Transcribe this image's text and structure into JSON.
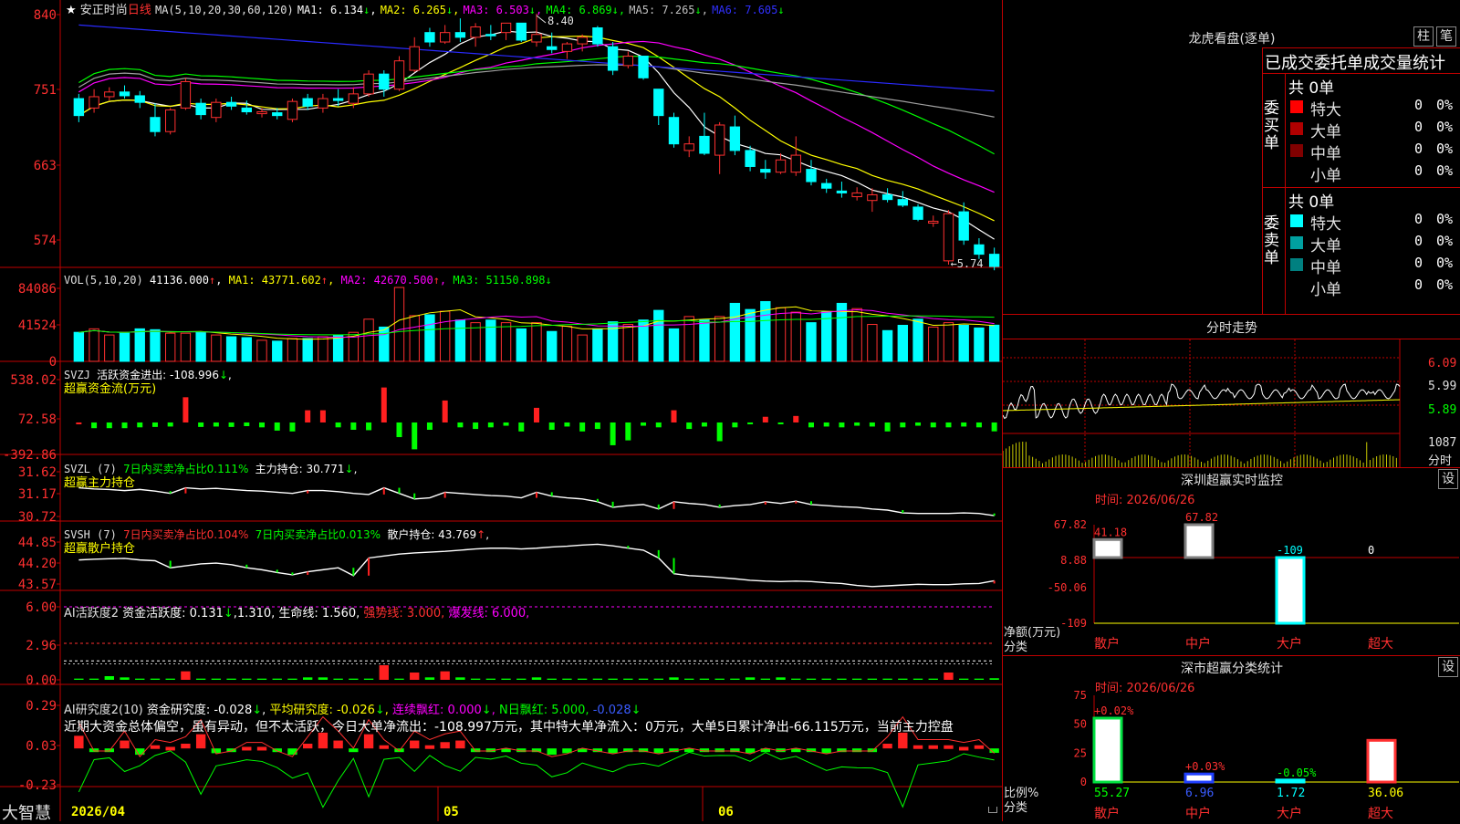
{
  "colors": {
    "up": "#ff3030",
    "down": "#00ffff",
    "grid": "#c00000",
    "ma1": "#ffffff",
    "ma2": "#ffff00",
    "ma3": "#ff00ff",
    "ma4": "#00ff00",
    "ma5": "#a0a0a0",
    "ma6": "#2a2aff"
  },
  "header": {
    "star": "★",
    "stock_name": "安正时尚",
    "period": "日线",
    "ma_params": "MA(5,10,20,30,60,120)",
    "ma1": "MA1: 6.134",
    "ma1_a": "↓",
    "ma2": "MA2: 6.265",
    "ma2_a": "↓",
    "ma3": "MA3: 6.503",
    "ma3_a": "↓",
    "ma4": "MA4: 6.869",
    "ma4_a": "↓",
    "ma5": "MA5: 7.265",
    "ma5_a": "↓",
    "ma6": "MA6: 7.605",
    "ma6_a": "↓"
  },
  "price_axis": [
    "840",
    "751",
    "663",
    "574"
  ],
  "high_label": "8.40",
  "low_label": "5.74",
  "low_arrow": "←",
  "vol_header": {
    "name": "VOL(5,10,20)",
    "val": "41136.000",
    "val_a": "↑",
    "ma1": "MA1: 43771.602",
    "ma1_a": "↑",
    "ma2": "MA2: 42670.500",
    "ma2_a": "↑",
    "ma3": "MA3: 51150.898",
    "ma3_a": "↓"
  },
  "vol_axis": [
    "84086",
    "41524",
    "0"
  ],
  "svzj_header": {
    "name": "SVZJ",
    "label": "活跃资金进出: -108.996",
    "arrow": "↓",
    "comma": ",",
    "sub": "超赢资金流(万元)"
  },
  "svzj_axis": [
    "538.02",
    "72.58",
    "-392.86"
  ],
  "svzl_header": {
    "name": "SVZL (7)",
    "label1": "7日内买卖净占比0.111%",
    "label2": "主力持仓: 30.771",
    "arrow": "↓",
    "comma": ",",
    "sub": "超赢主力持仓"
  },
  "svzl_axis": [
    "31.62",
    "31.17",
    "30.72"
  ],
  "svsh_header": {
    "name": "SVSH (7)",
    "label1": "7日内买卖净占比0.104%",
    "label2": "7日内买卖净占比0.013%",
    "label3": "散户持仓: 43.769",
    "arrow": "↑",
    "comma": ",",
    "sub": "超赢散户持仓"
  },
  "svsh_axis": [
    "44.85",
    "44.20",
    "43.57"
  ],
  "ai_act": {
    "name": "AI活跃度2",
    "l1": "资金活跃度: 0.131",
    "a1": "↓",
    "l2": ",1.310,",
    "l3": "生命线: 1.560,",
    "l4": "强势线: 3.000,",
    "l5": "爆发线: 6.000,"
  },
  "ai_act_axis": [
    "6.00",
    "2.96",
    "0.00"
  ],
  "ai_res": {
    "name": "AI研究度2(10)",
    "l1": "资金研究度: -0.028",
    "a1": "↓",
    "l2": "平均研究度: -0.026",
    "a2": "↓",
    "l3": "连续飘红: 0.000",
    "a3": "↓",
    "l4": "N日飘红: 5.000,",
    "l5": "-0.028",
    "a5": "↓",
    "text": "近期大资金总体偏空，虽有异动，但不太活跃，今日大单净流出：-108.997万元，其中特大单净流入：0万元，大单5日累计净出-66.115万元，当前主力控盘"
  },
  "ai_res_axis": [
    "0.29",
    "0.03",
    "-0.23"
  ],
  "bottom": {
    "brand": "大智慧",
    "date_start": "2026/04",
    "month1": "05",
    "month2": "06"
  },
  "right": {
    "tiger_title": "龙虎看盘(逐单)",
    "btn1": "柱",
    "btn2": "笔",
    "stats_title": "已成交委托单成交量统计",
    "buy": {
      "side": "委买单",
      "total": "共 0单",
      "rows": [
        {
          "label": "特大",
          "count": "0",
          "pct": "0%",
          "color": "#ff0000"
        },
        {
          "label": "大单",
          "count": "0",
          "pct": "0%",
          "color": "#b00000"
        },
        {
          "label": "中单",
          "count": "0",
          "pct": "0%",
          "color": "#800000"
        },
        {
          "label": "小单",
          "count": "0",
          "pct": "0%",
          "color": "#000000"
        }
      ]
    },
    "sell": {
      "side": "委卖单",
      "total": "共 0单",
      "rows": [
        {
          "label": "特大",
          "count": "0",
          "pct": "0%",
          "color": "#00ffff"
        },
        {
          "label": "大单",
          "count": "0",
          "pct": "0%",
          "color": "#00a0a0"
        },
        {
          "label": "中单",
          "count": "0",
          "pct": "0%",
          "color": "#008080"
        },
        {
          "label": "小单",
          "count": "0",
          "pct": "0%",
          "color": "#000000"
        }
      ]
    },
    "intraday_title": "分时走势",
    "intraday_axis": [
      "6.09",
      "5.99",
      "5.89"
    ],
    "intraday_vol": "1087",
    "intraday_vol_unit": "分时",
    "sz_title": "深圳超赢实时监控",
    "sz_btn": "设",
    "sz_time": "时间: 2026/06/26",
    "sz_axis": [
      "67.82",
      "8.88",
      "-50.06",
      "-109"
    ],
    "sz_unit": "净额(万元)",
    "sz_cat_label": "分类",
    "sz_bars": [
      {
        "name": "散户",
        "value": 41.18,
        "label": "41.18"
      },
      {
        "name": "中户",
        "value": 67.82,
        "label": "67.82"
      },
      {
        "name": "大户",
        "value": -109,
        "label": "-109"
      },
      {
        "name": "超大",
        "value": 0,
        "label": "0"
      }
    ],
    "cls_title": "深市超赢分类统计",
    "cls_btn": "设",
    "cls_time": "时间: 2026/06/26",
    "cls_axis": [
      "75",
      "50",
      "25",
      "0"
    ],
    "cls_unit": "比例%",
    "cls_cat_label": "分类",
    "cls_bars": [
      {
        "name": "散户",
        "value": 55.27,
        "top": "+0.02%",
        "bottom": "55.27"
      },
      {
        "name": "中户",
        "value": 6.96,
        "top": "+0.03%",
        "bottom": "6.96"
      },
      {
        "name": "大户",
        "value": 1.72,
        "top": "-0.05%",
        "bottom": "1.72"
      },
      {
        "name": "超大",
        "value": 36.06,
        "top": "",
        "bottom": "36.06"
      }
    ]
  },
  "chart_data": {
    "type": "candlestick",
    "title": "安正时尚 日线",
    "x_range": [
      "2026/04",
      "2026/06/26"
    ],
    "price_ylim": [
      5.74,
      8.4
    ],
    "candles_ohlc": [
      [
        7.5,
        7.55,
        7.25,
        7.32
      ],
      [
        7.4,
        7.6,
        7.35,
        7.52
      ],
      [
        7.52,
        7.62,
        7.48,
        7.57
      ],
      [
        7.57,
        7.64,
        7.5,
        7.53
      ],
      [
        7.53,
        7.58,
        7.4,
        7.46
      ],
      [
        7.3,
        7.45,
        7.1,
        7.15
      ],
      [
        7.15,
        7.4,
        7.12,
        7.38
      ],
      [
        7.4,
        7.72,
        7.38,
        7.68
      ],
      [
        7.45,
        7.5,
        7.28,
        7.33
      ],
      [
        7.3,
        7.5,
        7.25,
        7.46
      ],
      [
        7.46,
        7.52,
        7.38,
        7.42
      ],
      [
        7.4,
        7.48,
        7.33,
        7.36
      ],
      [
        7.34,
        7.4,
        7.3,
        7.36
      ],
      [
        7.35,
        7.4,
        7.28,
        7.32
      ],
      [
        7.28,
        7.5,
        7.25,
        7.47
      ],
      [
        7.5,
        7.55,
        7.38,
        7.42
      ],
      [
        7.4,
        7.55,
        7.35,
        7.5
      ],
      [
        7.5,
        7.6,
        7.42,
        7.48
      ],
      [
        7.45,
        7.62,
        7.4,
        7.55
      ],
      [
        7.55,
        7.8,
        7.52,
        7.76
      ],
      [
        7.76,
        7.8,
        7.52,
        7.6
      ],
      [
        7.6,
        7.95,
        7.58,
        7.9
      ],
      [
        7.8,
        8.15,
        7.78,
        8.05
      ],
      [
        8.2,
        8.25,
        8.05,
        8.1
      ],
      [
        8.1,
        8.28,
        8.08,
        8.2
      ],
      [
        8.2,
        8.35,
        8.1,
        8.15
      ],
      [
        8.15,
        8.3,
        8.05,
        8.26
      ],
      [
        8.18,
        8.28,
        8.12,
        8.17
      ],
      [
        8.2,
        8.3,
        8.12,
        8.3
      ],
      [
        8.3,
        8.3,
        8.1,
        8.12
      ],
      [
        8.1,
        8.4,
        8.05,
        8.18
      ],
      [
        8.05,
        8.2,
        7.98,
        8.02
      ],
      [
        8.0,
        8.1,
        7.92,
        8.08
      ],
      [
        8.08,
        8.18,
        8.0,
        8.15
      ],
      [
        8.25,
        8.27,
        8.05,
        8.08
      ],
      [
        8.05,
        8.1,
        7.75,
        7.8
      ],
      [
        7.85,
        8.0,
        7.82,
        7.95
      ],
      [
        7.95,
        7.95,
        7.7,
        7.72
      ],
      [
        7.6,
        7.6,
        7.22,
        7.32
      ],
      [
        7.3,
        7.35,
        6.98,
        7.02
      ],
      [
        6.95,
        7.1,
        6.88,
        7.02
      ],
      [
        7.1,
        7.35,
        6.9,
        6.92
      ],
      [
        6.9,
        7.25,
        6.7,
        7.22
      ],
      [
        7.2,
        7.32,
        6.9,
        6.95
      ],
      [
        6.95,
        7.0,
        6.73,
        6.78
      ],
      [
        6.75,
        6.85,
        6.65,
        6.72
      ],
      [
        6.72,
        6.92,
        6.7,
        6.85
      ],
      [
        6.72,
        7.1,
        6.68,
        6.9
      ],
      [
        6.75,
        6.85,
        6.58,
        6.62
      ],
      [
        6.6,
        6.65,
        6.5,
        6.55
      ],
      [
        6.52,
        6.62,
        6.45,
        6.5
      ],
      [
        6.46,
        6.56,
        6.42,
        6.5
      ],
      [
        6.42,
        6.55,
        6.3,
        6.48
      ],
      [
        6.48,
        6.55,
        6.4,
        6.43
      ],
      [
        6.43,
        6.52,
        6.35,
        6.37
      ],
      [
        6.35,
        6.38,
        6.2,
        6.22
      ],
      [
        6.18,
        6.26,
        6.14,
        6.2
      ],
      [
        5.78,
        6.32,
        5.74,
        6.28
      ],
      [
        6.3,
        6.4,
        5.95,
        6.0
      ],
      [
        5.95,
        6.02,
        5.8,
        5.85
      ],
      [
        5.85,
        5.92,
        5.68,
        5.72
      ]
    ],
    "volume_ylim": [
      0,
      84086
    ],
    "volume": [
      33000,
      37000,
      30000,
      32000,
      37000,
      36000,
      32000,
      32000,
      33000,
      30000,
      28000,
      27000,
      24000,
      23000,
      26000,
      26000,
      28000,
      30000,
      33000,
      48000,
      39000,
      84086,
      52000,
      53000,
      57000,
      47000,
      44000,
      47000,
      44000,
      37000,
      44000,
      34000,
      40000,
      30000,
      37000,
      45000,
      42000,
      47000,
      58000,
      37000,
      51000,
      47000,
      51000,
      66000,
      59000,
      68000,
      61000,
      56000,
      44000,
      56000,
      66000,
      60000,
      42000,
      35000,
      41000,
      48000,
      39000,
      44000,
      41000,
      38000,
      41136
    ],
    "series": [
      {
        "name": "SVZJ 活跃资金进出",
        "ylim": [
          -392.86,
          538.02
        ],
        "values": [
          0,
          -70,
          -70,
          -70,
          -60,
          -55,
          -50,
          310,
          -55,
          -50,
          -55,
          -45,
          -60,
          -100,
          -110,
          150,
          150,
          -60,
          -90,
          -95,
          430,
          -180,
          -330,
          -90,
          270,
          -60,
          -80,
          -60,
          -40,
          -110,
          180,
          -90,
          -50,
          -110,
          -80,
          -280,
          -220,
          -40,
          -60,
          150,
          -80,
          -50,
          -230,
          -60,
          -20,
          70,
          -20,
          80,
          -60,
          -50,
          -60,
          -40,
          -50,
          -110,
          -60,
          -40,
          -60,
          -60,
          -50,
          -60,
          -109
        ]
      },
      {
        "name": "SVZL 主力持仓",
        "ylim": [
          30.72,
          31.62
        ],
        "values": [
          31.3,
          31.28,
          31.27,
          31.25,
          31.27,
          31.24,
          31.2,
          31.3,
          31.28,
          31.29,
          31.27,
          31.25,
          31.24,
          31.22,
          31.2,
          31.25,
          31.25,
          31.23,
          31.2,
          31.18,
          31.3,
          31.2,
          31.1,
          31.12,
          31.22,
          31.2,
          31.18,
          31.16,
          31.15,
          31.12,
          31.22,
          31.15,
          31.12,
          31.1,
          31.05,
          30.95,
          30.98,
          31.0,
          30.92,
          31.05,
          31.02,
          31.0,
          30.95,
          30.98,
          31.0,
          31.05,
          31.02,
          31.06,
          31.0,
          30.98,
          30.96,
          30.95,
          30.92,
          30.9,
          30.85,
          30.84,
          30.84,
          30.84,
          30.85,
          30.84,
          30.8
        ]
      },
      {
        "name": "SVSH 散户持仓",
        "ylim": [
          43.57,
          44.85
        ],
        "values": [
          44.3,
          44.32,
          44.33,
          44.34,
          44.3,
          44.28,
          44.1,
          44.15,
          44.2,
          44.22,
          44.18,
          44.1,
          44.05,
          43.98,
          43.92,
          44.0,
          44.05,
          44.1,
          43.9,
          44.35,
          44.4,
          44.45,
          44.48,
          44.5,
          44.52,
          44.55,
          44.58,
          44.6,
          44.6,
          44.58,
          44.6,
          44.63,
          44.65,
          44.68,
          44.7,
          44.66,
          44.6,
          44.55,
          44.35,
          43.95,
          43.9,
          43.88,
          43.85,
          43.82,
          43.78,
          43.76,
          43.75,
          43.76,
          43.75,
          43.72,
          43.7,
          43.65,
          43.62,
          43.64,
          43.66,
          43.68,
          43.67,
          43.67,
          43.69,
          43.7,
          43.769
        ]
      },
      {
        "name": "AI活跃度2",
        "ylim": [
          0,
          6.0
        ],
        "values": [
          0.1,
          0.1,
          0.3,
          0.2,
          0.1,
          0.1,
          0.1,
          0.7,
          0.1,
          0.1,
          0.1,
          0.1,
          0.1,
          0.1,
          0.1,
          0.2,
          0.2,
          0.1,
          0.1,
          0.1,
          1.2,
          0.1,
          0.6,
          0.2,
          0.7,
          0.2,
          0.1,
          0.1,
          0.1,
          0.1,
          0.2,
          0.1,
          0.1,
          0.1,
          0.1,
          0.1,
          0.1,
          0.1,
          0.1,
          0.2,
          0.1,
          0.1,
          0.1,
          0.1,
          0.2,
          0.1,
          0.2,
          0.1,
          0.1,
          0.1,
          0.1,
          0.1,
          0.1,
          0.1,
          0.1,
          0.1,
          0.1,
          0.6,
          0.1,
          0.1,
          0.131
        ]
      },
      {
        "name": "AI研究度2(10)",
        "ylim": [
          -0.23,
          0.29
        ],
        "values": [
          0.08,
          -0.02,
          -0.02,
          0.05,
          -0.04,
          0.02,
          0.01,
          0.03,
          0.09,
          -0.03,
          -0.02,
          0.01,
          0.01,
          -0.02,
          -0.04,
          0.03,
          0.1,
          0.05,
          -0.01,
          0.09,
          0.02,
          -0.02,
          0.05,
          0.02,
          0.04,
          0.05,
          -0.02,
          -0.02,
          -0.01,
          -0.02,
          -0.02,
          -0.04,
          -0.03,
          -0.01,
          -0.02,
          -0.03,
          -0.02,
          -0.02,
          -0.03,
          -0.02,
          -0.01,
          -0.02,
          -0.02,
          -0.02,
          -0.03,
          -0.01,
          -0.02,
          -0.01,
          -0.02,
          -0.03,
          -0.02,
          -0.02,
          -0.02,
          0.03,
          0.1,
          0.02,
          0.02,
          0.02,
          0.01,
          0.02,
          -0.028
        ]
      }
    ],
    "intraday_ylim": [
      5.89,
      6.09
    ]
  }
}
